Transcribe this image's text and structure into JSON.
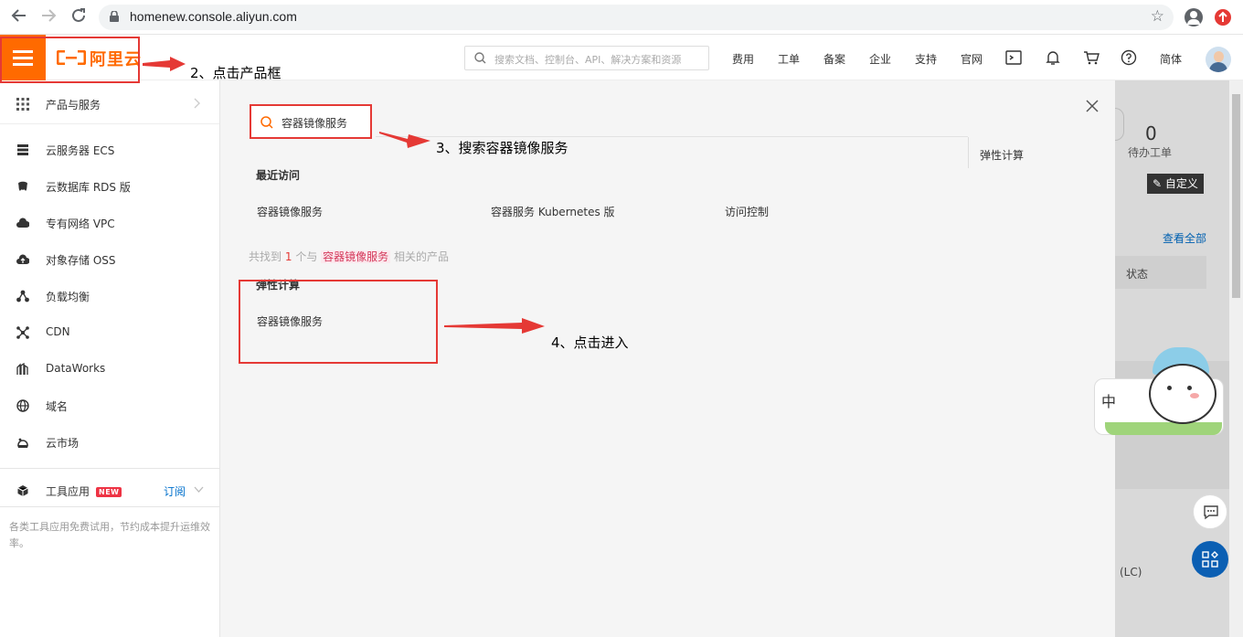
{
  "browser": {
    "url": "homenew.console.aliyun.com"
  },
  "topnav": {
    "logo_text": "阿里云",
    "search_placeholder": "搜索文档、控制台、API、解决方案和资源",
    "items": [
      "费用",
      "工单",
      "备案",
      "企业",
      "支持",
      "官网"
    ],
    "lang": "简体"
  },
  "sidebar": {
    "header": "产品与服务",
    "items": [
      {
        "label": "云服务器 ECS",
        "icon": "server-icon"
      },
      {
        "label": "云数据库 RDS 版",
        "icon": "database-icon"
      },
      {
        "label": "专有网络 VPC",
        "icon": "cloud-network-icon"
      },
      {
        "label": "对象存储 OSS",
        "icon": "cloud-storage-icon"
      },
      {
        "label": "负载均衡",
        "icon": "load-balancer-icon"
      },
      {
        "label": "CDN",
        "icon": "cdn-icon"
      },
      {
        "label": "DataWorks",
        "icon": "dataworks-icon"
      },
      {
        "label": "域名",
        "icon": "globe-icon"
      },
      {
        "label": "云市场",
        "icon": "market-icon"
      }
    ],
    "tools_label": "工具应用",
    "tools_badge": "NEW",
    "subscribe_label": "订阅",
    "tools_desc": "各类工具应用免费试用，节约成本提升运维效率。"
  },
  "panel": {
    "search_value": "容器镜像服务",
    "category_right": "弹性计算",
    "recent_title": "最近访问",
    "recent_items": [
      "容器镜像服务",
      "容器服务 Kubernetes 版",
      "访问控制"
    ],
    "found_prefix": "共找到",
    "found_count": "1",
    "found_mid": "个与",
    "found_keyword": "容器镜像服务",
    "found_suffix": "相关的产品",
    "result_category": "弹性计算",
    "result_item": "容器镜像服务"
  },
  "background": {
    "pending_count": "0",
    "pending_label": "待办工单",
    "customize_label": "自定义",
    "view_all": "查看全部",
    "status_col": "状态",
    "lc_text": "(LC)",
    "mascot_text": "中"
  },
  "annotations": {
    "step2": "2、点击产品框",
    "step3": "3、搜索容器镜像服务",
    "step4": "4、点击进入"
  },
  "colors": {
    "brand": "#ff6a00",
    "annotation_red": "#e53935",
    "link_blue": "#0070cc"
  }
}
